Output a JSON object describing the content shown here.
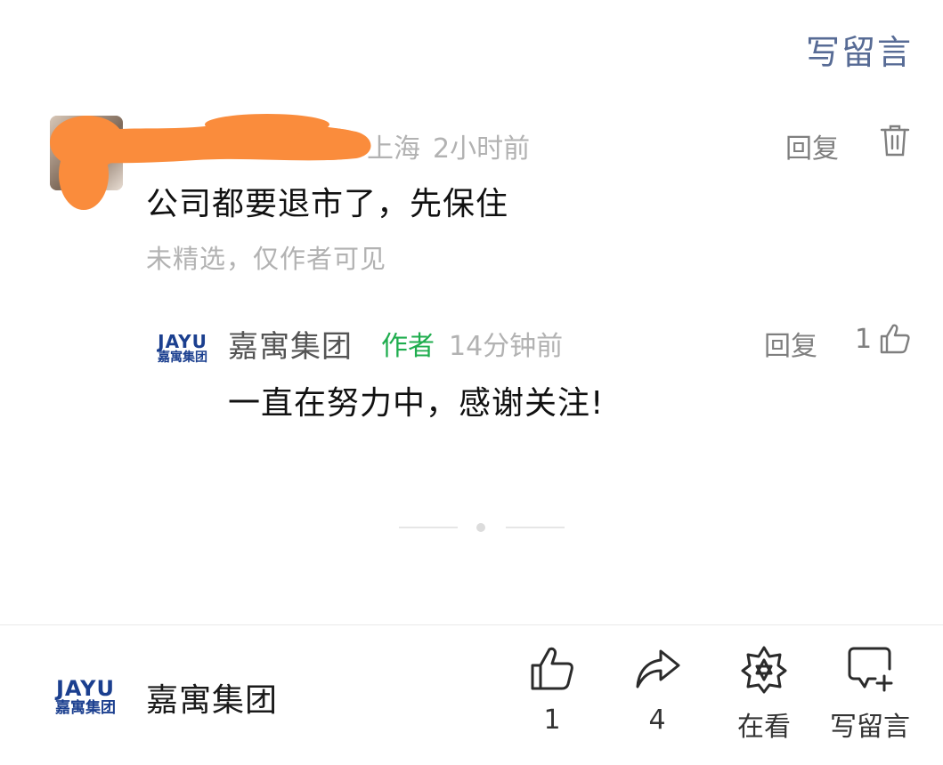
{
  "header": {
    "write_comment_label": "写留言"
  },
  "comment": {
    "location": "上海",
    "time": "2小时前",
    "text": "公司都要退市了，先保住",
    "notice": "未精选，仅作者可见",
    "reply_label": "回复",
    "delete_icon": "trash-icon"
  },
  "author_reply": {
    "logo_en": "JAYU",
    "logo_cn": "嘉寓集团",
    "name": "嘉寓集团",
    "tag": "作者",
    "time": "14分钟前",
    "text": "一直在努力中，感谢关注!",
    "reply_label": "回复",
    "like_count": "1",
    "like_icon": "thumbs-up-icon"
  },
  "bottom_bar": {
    "logo_en": "JAYU",
    "logo_cn": "嘉寓集团",
    "account_name": "嘉寓集团",
    "actions": [
      {
        "icon": "thumbs-up-icon",
        "label": "1"
      },
      {
        "icon": "share-icon",
        "label": "4"
      },
      {
        "icon": "wow-star-icon",
        "label": "在看"
      },
      {
        "icon": "comment-add-icon",
        "label": "写留言"
      }
    ]
  },
  "colors": {
    "link_blue": "#576b95",
    "author_green": "#1fad4e",
    "brand_blue": "#1b3f8f",
    "redaction_orange": "#fa8c3c"
  }
}
